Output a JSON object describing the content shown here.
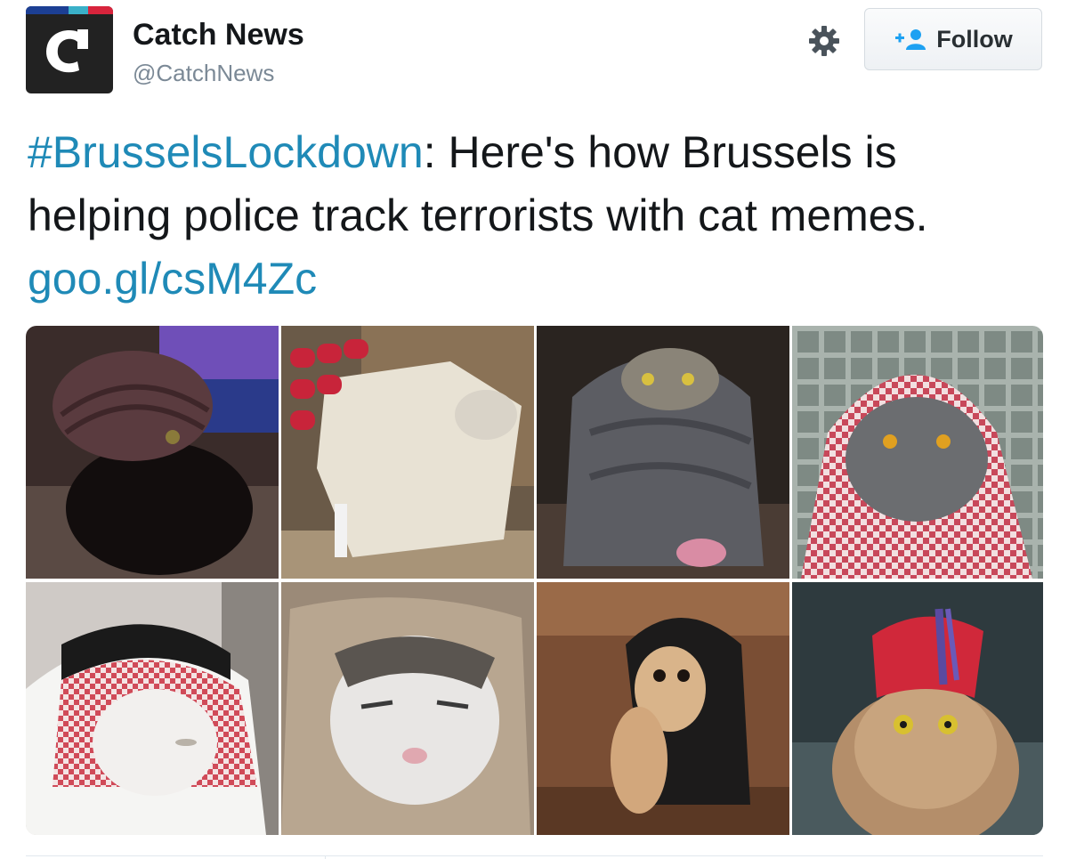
{
  "header": {
    "display_name": "Catch News",
    "handle": "@CatchNews",
    "avatar_letter": "c",
    "follow_label": "Follow",
    "gear_icon": "gear-icon",
    "follow_icon": "add-user-icon"
  },
  "tweet": {
    "hashtag": "#BrusselsLockdown",
    "body": ": Here's how Brussels is helping police track terrorists with cat memes. ",
    "link": "goo.gl/csM4Zc"
  },
  "colors": {
    "link": "#1f8ab7",
    "text": "#14171a",
    "secondary": "#7b8996"
  }
}
